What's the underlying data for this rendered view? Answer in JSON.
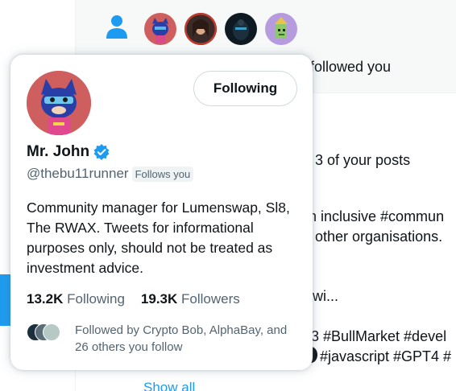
{
  "background": {
    "notification_text": "s followed you",
    "lines": [
      "l 3 of your posts",
      "n inclusive #commun",
      "other organisations.",
      "/wi...",
      "3 #BullMarket #devel",
      "#javascript #GPT4 #"
    ],
    "show_all": "Show all"
  },
  "card": {
    "follow_button": "Following",
    "name": "Mr. John",
    "handle": "@thebu11runner",
    "follows_you": "Follows you",
    "bio": "Community manager for Lumenswap, Sl8, The RWAX. Tweets for informational purposes only, should not be treated as investment advice.",
    "following_count": "13.2K",
    "following_label": "Following",
    "followers_count": "19.3K",
    "followers_label": "Followers",
    "mutual_text": "Followed by Crypto Bob, AlphaBay, and 26 others you follow"
  },
  "colors": {
    "accent": "#1d9bf0",
    "avatar_bg": "#cf5f5f",
    "secondary_text": "#536471"
  }
}
